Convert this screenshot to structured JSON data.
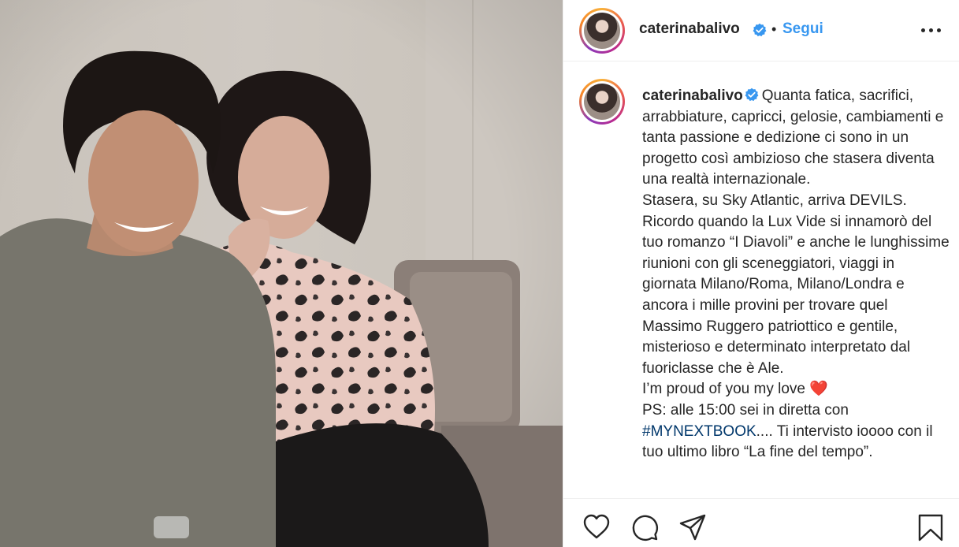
{
  "post": {
    "author": {
      "username": "caterinabalivo",
      "verified": true,
      "avatar_icon": "profile-avatar"
    },
    "header": {
      "separator": "•",
      "follow_label": "Segui",
      "more_icon": "more-options-icon"
    },
    "caption": {
      "username": "caterinabalivo",
      "text_part1": "Quanta fatica, sacrifici, arrabbiature, capricci, gelosie, cambiamenti e tanta passione e dedizione ci sono in un progetto così ambizioso che stasera diventa una realtà internazionale.\nStasera, su Sky Atlantic, arriva DEVILS.\nRicordo quando la Lux Vide si innamorò del tuo romanzo “I Diavoli” e anche le lunghissime riunioni con gli sceneggiatori, viaggi in giornata Milano/Roma, Milano/Londra e ancora i mille provini per trovare quel Massimo Ruggero patriottico e gentile, misterioso e determinato interpretato dal fuoriclasse che è Ale.\nI’m proud of you my love ",
      "heart_emoji": "❤️",
      "text_part2": "\nPS: alle 15:00 sei in diretta con ",
      "hashtag": "#MYNEXTBOOK",
      "text_part3": ".... Ti intervisto ioooo con il tuo ultimo libro “La fine del tempo”."
    },
    "actions": {
      "like_icon": "heart-icon",
      "comment_icon": "comment-icon",
      "share_icon": "share-icon",
      "save_icon": "bookmark-icon"
    },
    "colors": {
      "follow_blue": "#3897f0",
      "hashtag": "#00376b",
      "verified_blue": "#3897f0",
      "text": "#262626",
      "divider": "#efefef"
    }
  }
}
